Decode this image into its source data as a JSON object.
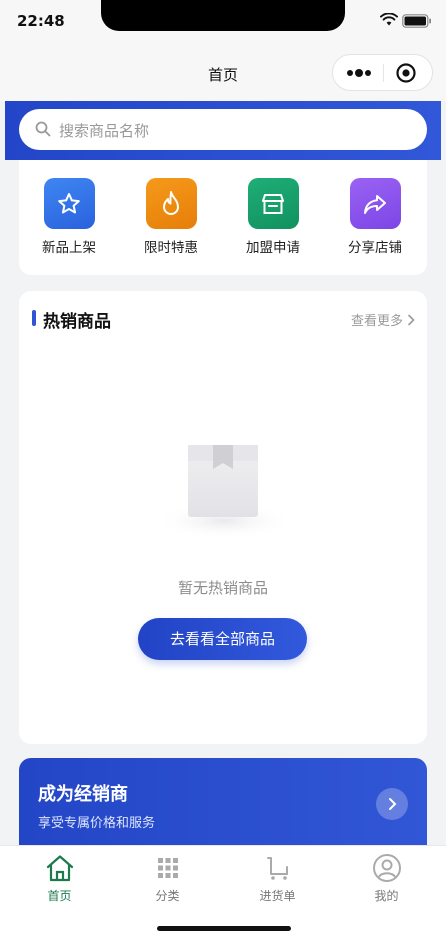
{
  "status": {
    "time": "22:48"
  },
  "nav": {
    "title": "首页"
  },
  "search": {
    "placeholder": "搜索商品名称"
  },
  "quick_actions": [
    {
      "label": "新品上架",
      "icon": "star-icon",
      "color": "#2f6fe4"
    },
    {
      "label": "限时特惠",
      "icon": "flame-icon",
      "color": "#ee8a0d"
    },
    {
      "label": "加盟申请",
      "icon": "store-icon",
      "color": "#169c6a"
    },
    {
      "label": "分享店铺",
      "icon": "share-icon",
      "color": "#8b52ee"
    }
  ],
  "hot_section": {
    "title": "热销商品",
    "see_more": "查看更多",
    "empty_text": "暂无热销商品",
    "button": "去看看全部商品"
  },
  "dealer_banner": {
    "title": "成为经销商",
    "subtitle": "享受专属价格和服务"
  },
  "tabs": [
    {
      "label": "首页",
      "icon": "home-icon",
      "active": true
    },
    {
      "label": "分类",
      "icon": "grid-icon",
      "active": false
    },
    {
      "label": "进货单",
      "icon": "cart-icon",
      "active": false
    },
    {
      "label": "我的",
      "icon": "user-icon",
      "active": false
    }
  ],
  "colors": {
    "primary": "#2d52d2",
    "active_tab": "#1c7a4e"
  }
}
